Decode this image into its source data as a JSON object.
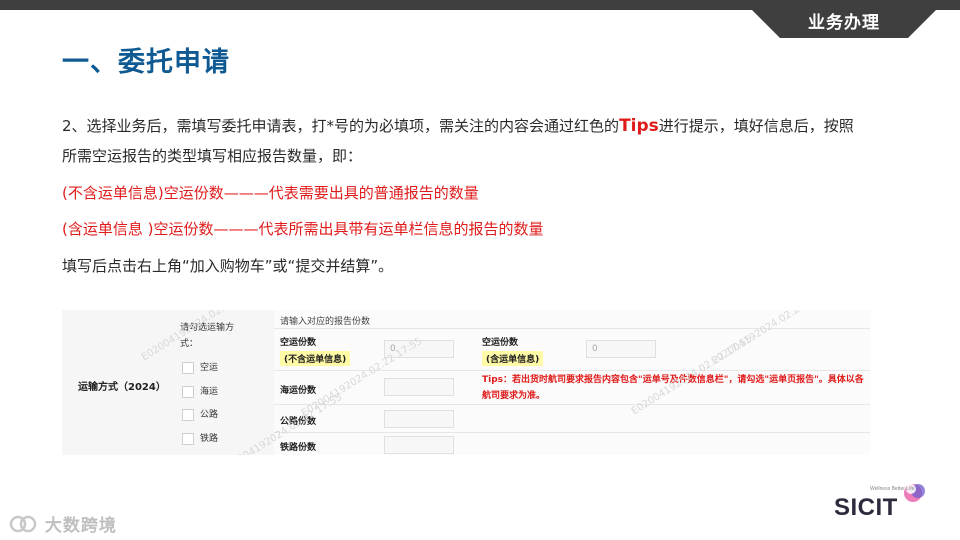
{
  "header": {
    "badge": "业务办理",
    "title": "一、委托申请"
  },
  "content": {
    "p1_a": "2、选择业务后，需填写委托申请表，打*号的为必填项，需关注的内容会通过红色的",
    "p1_tips": "Tips",
    "p1_b": "进行提示，填好信息后，按照所需空运报告的类型填写相应报告数量，即：",
    "p2": "(不含运单信息)空运份数———代表需要出具的普通报告的数量",
    "p3": "(含运单信息 )空运份数———代表所需出具带有运单栏信息的报告的数量",
    "p4": "填写后点击右上角“加入购物车”或“提交并结算”。"
  },
  "form": {
    "mode_label": "运输方式（2024）",
    "pick_label": "请勾选运输方式：",
    "options": [
      "空运",
      "海运",
      "公路",
      "铁路"
    ],
    "header": "请输入对应的报告份数",
    "air_label_1": "空运份数",
    "air_note_1": "(不含运单信息)",
    "air_value_1": "0",
    "air_label_2": "空运份数",
    "air_note_2": "(含运单信息)",
    "air_value_2": "0",
    "sea_label": "海运份数",
    "road_label": "公路份数",
    "rail_label": "铁路份数",
    "tips": "Tips：若出货时航司要求报告内容包含\"运单号及件数信息栏\"，请勾选\"运单页报告\"。具体以各航司要求为准。",
    "watermark": "E02004192024.02.22 17:55"
  },
  "footer": {
    "watermark": "大数跨境",
    "logo": "SICIT",
    "logo_tag": "Wellness Better Life"
  },
  "colors": {
    "title": "#0f5a93",
    "badge_bg": "#3f3f3f",
    "red": "#e01b1b",
    "highlight": "#fffaa6"
  }
}
